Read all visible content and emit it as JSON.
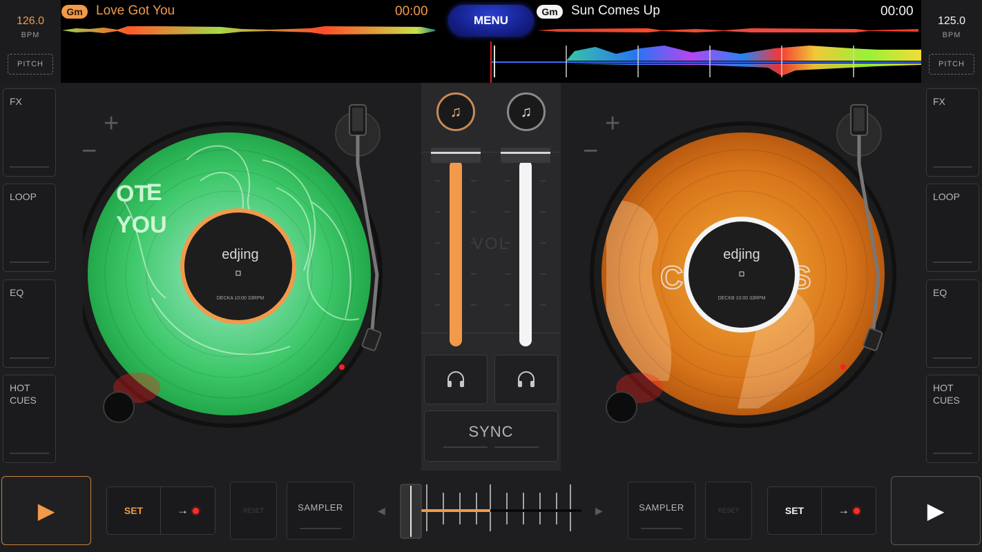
{
  "deck_a": {
    "bpm": "126.0",
    "bpm_unit": "BPM",
    "pitch_label": "PITCH",
    "key": "Gm",
    "title": "Love Got You",
    "time": "00:00",
    "accent": "#f29a4a",
    "record_label": "edjing",
    "record_sublabel": "DECKA 10:00 33RPM",
    "cover_text": [
      "E",
      "OT",
      "YOU"
    ],
    "play_icon": "▶",
    "cue_set_label": "SET",
    "cue_go_icon": "→",
    "reset_label": "RESET",
    "sampler_label": "SAMPLER"
  },
  "deck_b": {
    "bpm": "125.0",
    "bpm_unit": "BPM",
    "pitch_label": "PITCH",
    "key": "Gm",
    "title": "Sun Comes Up",
    "time": "00:00",
    "accent": "#f4f4f4",
    "record_label": "edjing",
    "record_sublabel": "DECKB 10:00 33RPM",
    "play_icon": "▶",
    "cue_set_label": "SET",
    "cue_go_icon": "→",
    "reset_label": "RESET",
    "sampler_label": "SAMPLER"
  },
  "menu_label": "MENU",
  "side_panel": [
    "FX",
    "LOOP",
    "EQ",
    "HOT\nCUES"
  ],
  "mixer": {
    "vol_label": "VOL",
    "sync_label": "SYNC",
    "fx_icon": "♫",
    "headphone_icon": "🎧",
    "volume_a": 1.0,
    "volume_b": 1.0
  },
  "crossfader": {
    "position": 0.0,
    "left_arrow": "◀",
    "right_arrow": "▶"
  },
  "icons": {
    "plus": "+",
    "minus": "−"
  }
}
